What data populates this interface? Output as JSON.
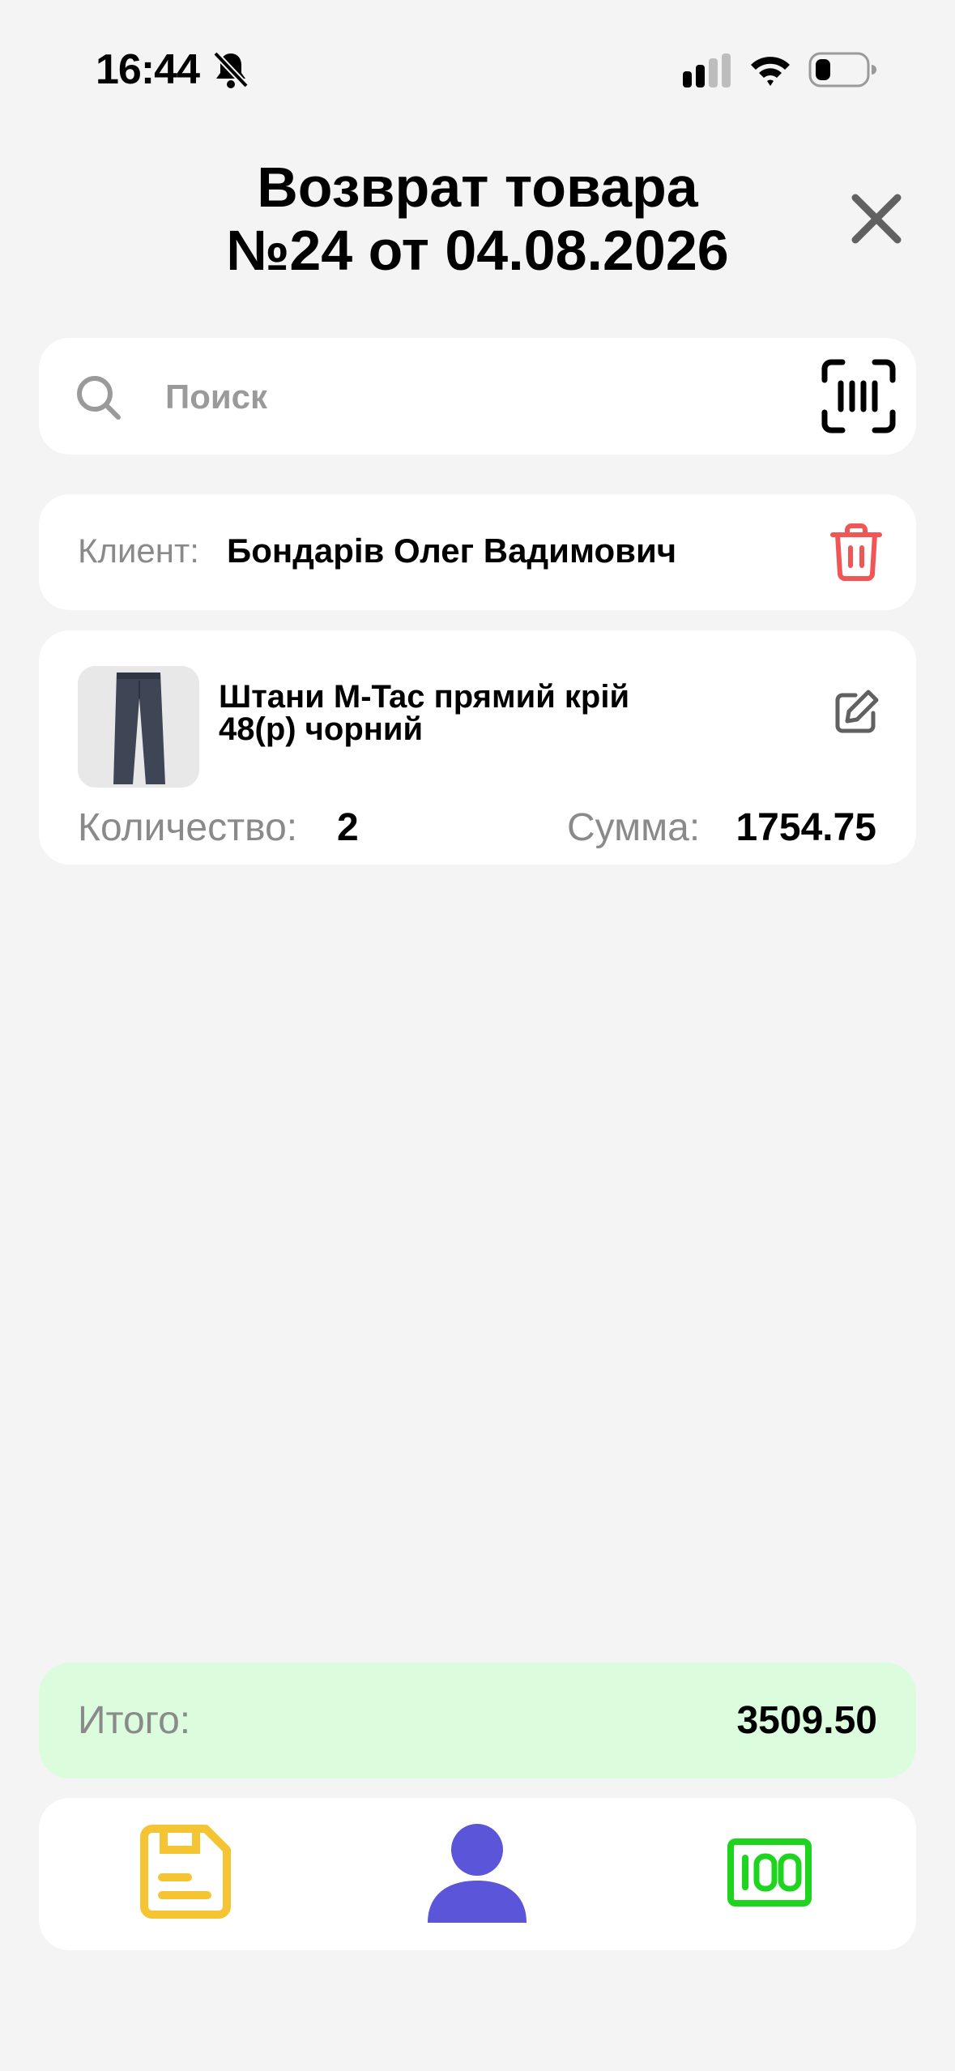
{
  "status_bar": {
    "time": "16:44",
    "icons": [
      "bell-slash-icon",
      "signal-icon",
      "wifi-icon",
      "battery-icon"
    ]
  },
  "header": {
    "title_line1": "Возврат товара",
    "title_line2": "№24 от 04.08.2026",
    "close_icon": "close-icon"
  },
  "search": {
    "placeholder": "Поиск",
    "value": "",
    "icon": "search-icon",
    "scan_icon": "barcode-scan-icon"
  },
  "client": {
    "label": "Клиент:",
    "name": "Бондарів Олег Вадимович",
    "delete_icon": "trash-icon"
  },
  "items": [
    {
      "title_line1": "Штани M-Tac прямий крій",
      "title_line2": "48(р) чорний",
      "quantity_label": "Количество:",
      "quantity": "2",
      "sum_label": "Сумма:",
      "sum": "1754.75",
      "edit_icon": "edit-icon"
    }
  ],
  "total": {
    "label": "Итого:",
    "value": "3509.50"
  },
  "bottom_bar": {
    "buttons": [
      "save-icon",
      "user-icon",
      "cash-icon"
    ]
  },
  "colors": {
    "background": "#f4f4f4",
    "card": "#ffffff",
    "total_bg": "#dcfcde",
    "save": "#f5c433",
    "user": "#5b55d9",
    "cash": "#1ed41e",
    "delete": "#f05656"
  }
}
